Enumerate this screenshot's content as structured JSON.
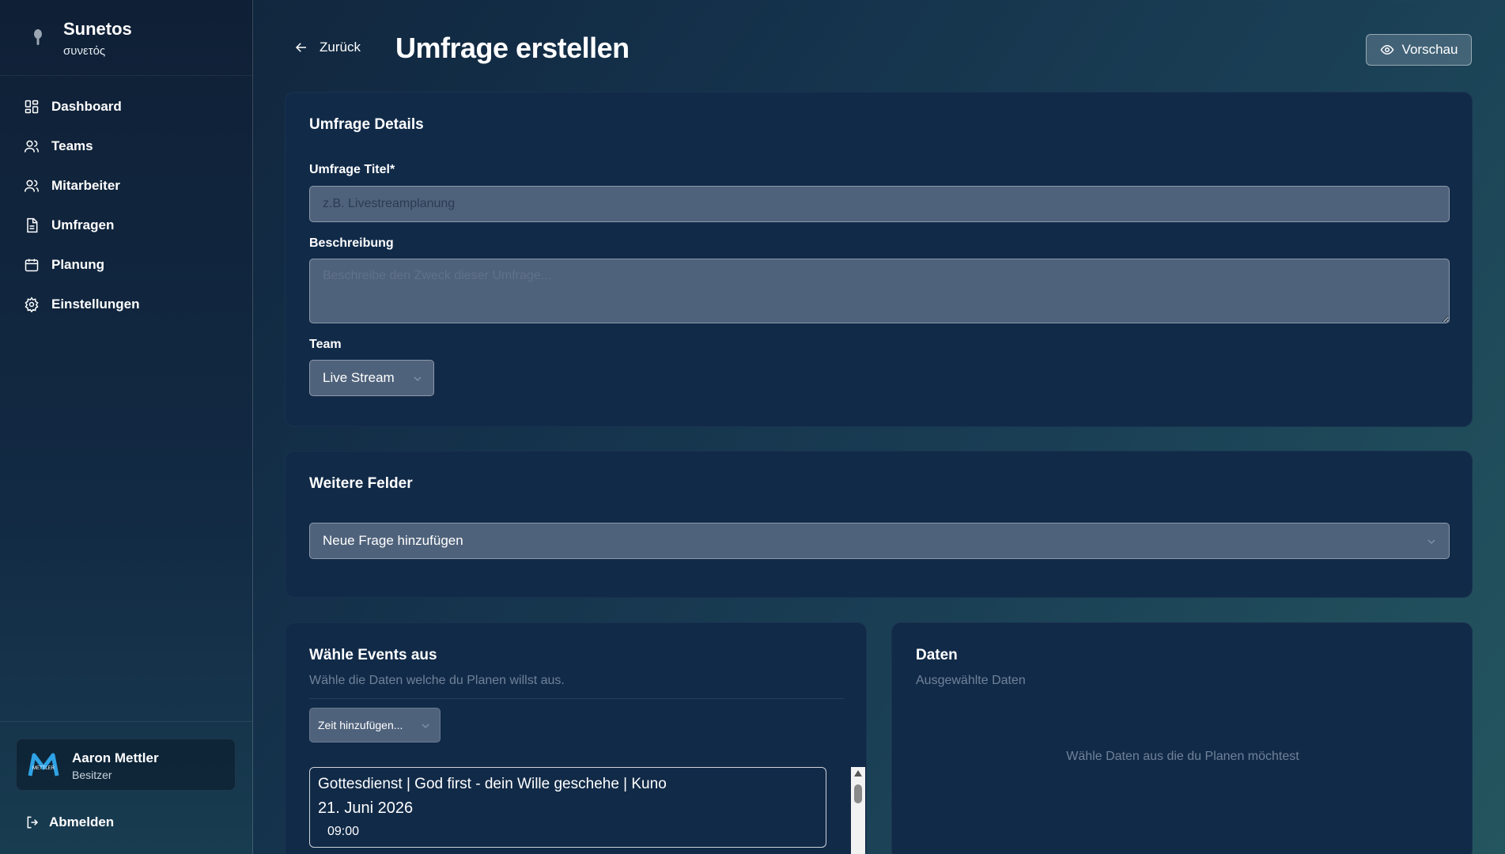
{
  "brand": {
    "name": "Sunetos",
    "subtitle": "συνετός"
  },
  "sidebar": {
    "items": [
      {
        "label": "Dashboard",
        "icon": "dashboard-icon"
      },
      {
        "label": "Teams",
        "icon": "users-icon"
      },
      {
        "label": "Mitarbeiter",
        "icon": "users-icon"
      },
      {
        "label": "Umfragen",
        "icon": "document-icon"
      },
      {
        "label": "Planung",
        "icon": "calendar-icon"
      },
      {
        "label": "Einstellungen",
        "icon": "gear-icon"
      }
    ],
    "user": {
      "name": "Aaron Mettler",
      "role": "Besitzer",
      "avatar_text": "METTLER"
    },
    "logout_label": "Abmelden"
  },
  "header": {
    "back_label": "Zurück",
    "title": "Umfrage erstellen",
    "preview_label": "Vorschau"
  },
  "details": {
    "card_title": "Umfrage Details",
    "title_label": "Umfrage Titel*",
    "title_placeholder": "z.B. Livestreamplanung",
    "title_value": "",
    "description_label": "Beschreibung",
    "description_placeholder": "Beschreibe den Zweck dieser Umfrage...",
    "team_label": "Team",
    "team_value": "Live Stream"
  },
  "fields": {
    "card_title": "Weitere Felder",
    "add_question_label": "Neue Frage hinzufügen"
  },
  "events": {
    "card_title": "Wähle Events aus",
    "subtitle": "Wähle die Daten welche du Planen willst aus.",
    "add_time_label": "Zeit hinzufügen...",
    "items": [
      {
        "title": "Gottesdienst | God first - dein Wille geschehe | Kuno",
        "date": "21. Juni 2026",
        "time": "09:00"
      }
    ]
  },
  "dates": {
    "card_title": "Daten",
    "subtitle": "Ausgewählte Daten",
    "empty_message": "Wähle Daten aus die du Planen möchtest"
  },
  "colors": {
    "card_bg": "#112a48",
    "input_bg": "#4f627b",
    "muted_text": "#6f8299"
  }
}
